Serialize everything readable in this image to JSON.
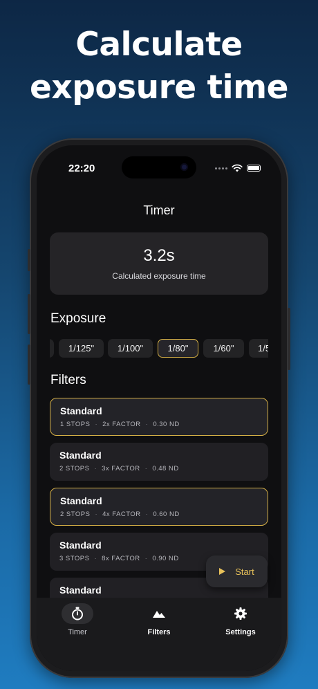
{
  "headline": {
    "line1": "Calculate",
    "line2": "exposure time"
  },
  "status_bar": {
    "time": "22:20"
  },
  "nav": {
    "title": "Timer"
  },
  "exposure": {
    "value": "3.2s",
    "caption": "Calculated exposure time"
  },
  "exposure_section": {
    "label": "Exposure",
    "options": [
      "1/125\"",
      "1/100\"",
      "1/80\"",
      "1/60\"",
      "1/5"
    ],
    "selected": "1/80\""
  },
  "filters_section": {
    "label": "Filters",
    "items": [
      {
        "name": "Standard",
        "stops": "1 STOPS",
        "factor": "2x FACTOR",
        "nd": "0.30 ND",
        "selected": true
      },
      {
        "name": "Standard",
        "stops": "2 STOPS",
        "factor": "3x FACTOR",
        "nd": "0.48 ND",
        "selected": false
      },
      {
        "name": "Standard",
        "stops": "2 STOPS",
        "factor": "4x FACTOR",
        "nd": "0.60 ND",
        "selected": true
      },
      {
        "name": "Standard",
        "stops": "3 STOPS",
        "factor": "8x FACTOR",
        "nd": "0.90 ND",
        "selected": false
      },
      {
        "name": "Standard",
        "stops": "",
        "factor": "",
        "nd": "",
        "selected": false
      }
    ]
  },
  "start_button": {
    "label": "Start",
    "icon": "play-icon"
  },
  "tabs": [
    {
      "label": "Timer",
      "icon": "stopwatch-icon",
      "active": true
    },
    {
      "label": "Filters",
      "icon": "mountains-icon",
      "active": false
    },
    {
      "label": "Settings",
      "icon": "gear-icon",
      "active": false
    }
  ],
  "colors": {
    "accent": "#d6b046",
    "background_top": "#0d2745",
    "background_bottom": "#1f7cc0",
    "screen": "#0f0f11",
    "card": "#252427"
  }
}
